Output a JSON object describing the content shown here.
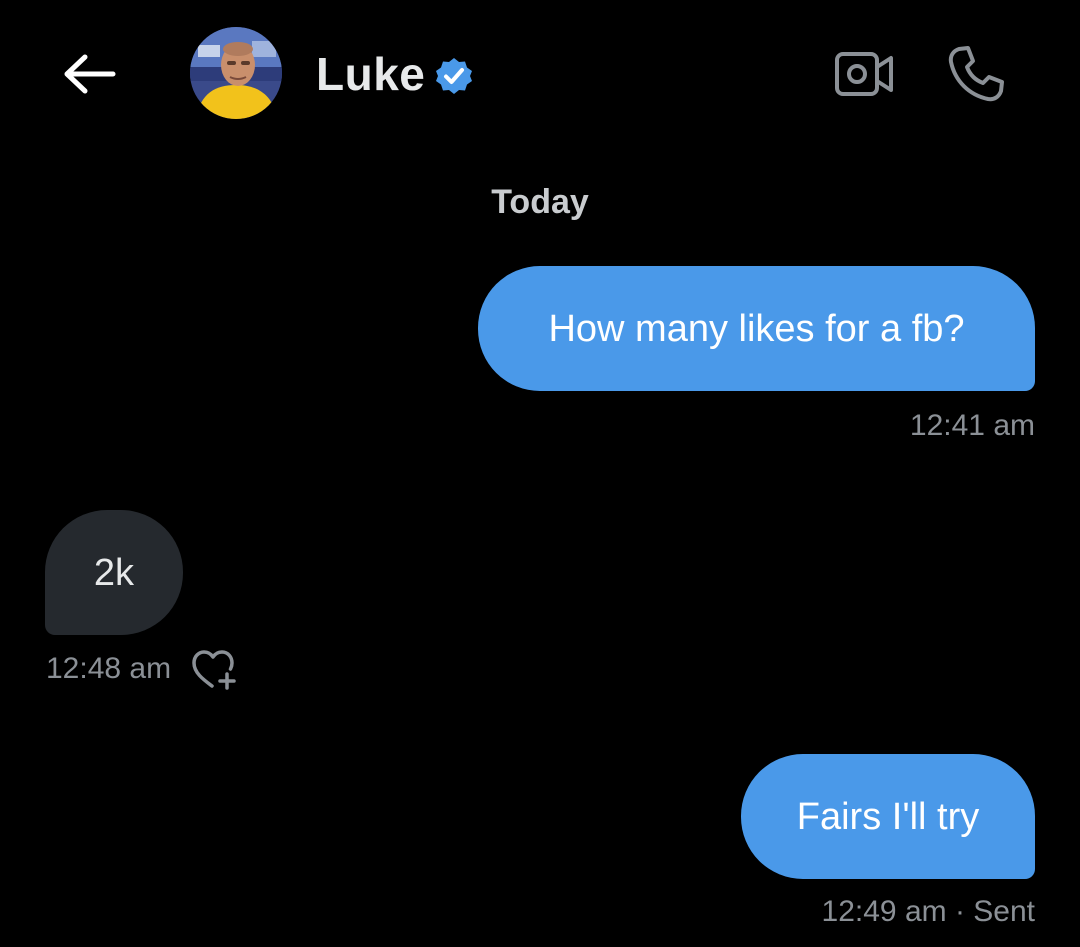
{
  "header": {
    "back_icon": "arrow-left-icon",
    "avatar_icon": "user-avatar",
    "name": "Luke",
    "verified_icon": "verified-badge-icon",
    "video_icon": "video-camera-icon",
    "call_icon": "phone-icon"
  },
  "day_separator": "Today",
  "messages": [
    {
      "direction": "outgoing",
      "text": "How many likes for a fb?",
      "time": "12:41 am"
    },
    {
      "direction": "incoming",
      "text": "2k",
      "time": "12:48 am",
      "reaction_icon": "heart-plus-icon"
    },
    {
      "direction": "outgoing",
      "text": "Fairs I'll try",
      "time": "12:49 am · Sent"
    }
  ],
  "colors": {
    "background": "#000000",
    "outgoing_bubble": "#4a99e9",
    "incoming_bubble": "#25292e",
    "verified": "#4a99e9",
    "muted_text": "#8b9096"
  }
}
